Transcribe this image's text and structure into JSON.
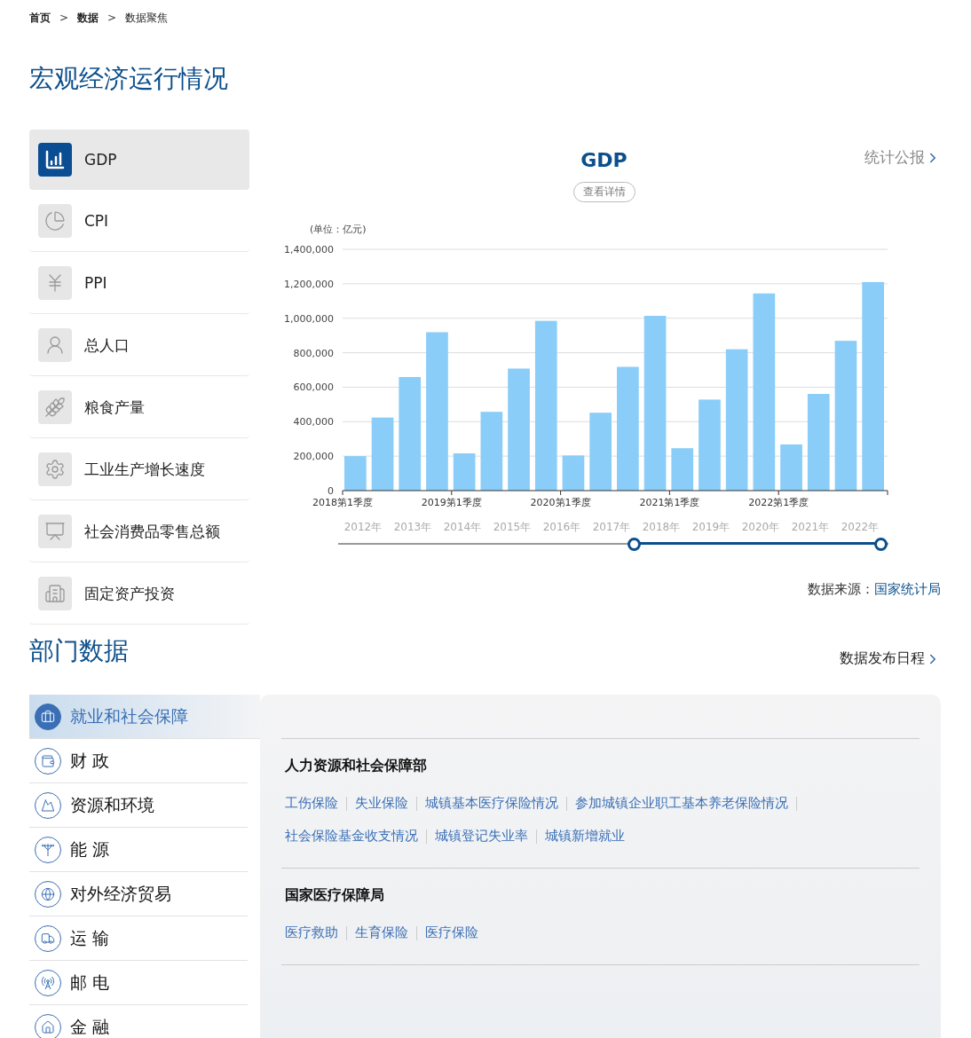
{
  "breadcrumb": [
    {
      "label": "首页",
      "current": false
    },
    {
      "label": "数据",
      "current": false
    },
    {
      "label": "数据聚焦",
      "current": true
    }
  ],
  "breadcrumb_separator": ">",
  "macro": {
    "title": "宏观经济运行情况",
    "indicators": [
      {
        "label": "GDP",
        "selected": true
      },
      {
        "label": "CPI",
        "selected": false
      },
      {
        "label": "PPI",
        "selected": false
      },
      {
        "label": "总人口",
        "selected": false
      },
      {
        "label": "粮食产量",
        "selected": false
      },
      {
        "label": "工业生产增长速度",
        "selected": false
      },
      {
        "label": "社会消费品零售总额",
        "selected": false
      },
      {
        "label": "固定资产投资",
        "selected": false
      }
    ],
    "chart_title": "GDP",
    "details_button": "查看详情",
    "bulletin_link": "统计公报",
    "chart_data": {
      "type": "bar",
      "ylabel": "(单位：亿元)",
      "grid": true,
      "categories": [
        "2018第1季度",
        null,
        null,
        null,
        "2019第1季度",
        null,
        null,
        null,
        "2020第1季度",
        null,
        null,
        null,
        "2021第1季度",
        null,
        null,
        null,
        "2022第1季度",
        null,
        null,
        null
      ],
      "values": [
        200000,
        424000,
        659000,
        919000,
        216000,
        457000,
        708000,
        985000,
        204000,
        452000,
        718000,
        1014000,
        246000,
        528000,
        820000,
        1144000,
        268000,
        561000,
        869000,
        1210000
      ],
      "ylim": [
        0,
        1400000
      ],
      "yticks": [
        {
          "value": 0,
          "label": "0"
        },
        {
          "value": 200000,
          "label": "200,000"
        },
        {
          "value": 400000,
          "label": "400,000"
        },
        {
          "value": 600000,
          "label": "600,000"
        },
        {
          "value": 800000,
          "label": "800,000"
        },
        {
          "value": 1000000,
          "label": "1,000,000"
        },
        {
          "value": 1200000,
          "label": "1,200,000"
        },
        {
          "value": 1400000,
          "label": "1,400,000"
        }
      ]
    },
    "timeline": {
      "years": [
        "2012年",
        "2013年",
        "2014年",
        "2015年",
        "2016年",
        "2017年",
        "2018年",
        "2019年",
        "2020年",
        "2021年",
        "2022年"
      ],
      "handles": [
        {
          "level": 0.54
        },
        {
          "level": 1
        }
      ]
    },
    "source_label": "数据来源：",
    "source_link": "国家统计局"
  },
  "departments": {
    "title": "部门数据",
    "schedule_link": "数据发布日程",
    "items": [
      {
        "label": "就业和社会保障",
        "selected": true
      },
      {
        "label": "财 政",
        "selected": false
      },
      {
        "label": "资源和环境",
        "selected": false
      },
      {
        "label": "能 源",
        "selected": false
      },
      {
        "label": "对外经济贸易",
        "selected": false
      },
      {
        "label": "运 输",
        "selected": false
      },
      {
        "label": "邮 电",
        "selected": false
      },
      {
        "label": "金 融",
        "selected": false
      }
    ],
    "groups": [
      {
        "title": "人力资源和社会保障部",
        "links": [
          "工伤保险",
          "失业保险",
          "城镇基本医疗保险情况",
          "参加城镇企业职工基本养老保险情况",
          "社会保险基金收支情况",
          "城镇登记失业率",
          "城镇新增就业"
        ]
      },
      {
        "title": "国家医疗保障局",
        "links": [
          "医疗救助",
          "生育保险",
          "医疗保险"
        ]
      }
    ]
  }
}
